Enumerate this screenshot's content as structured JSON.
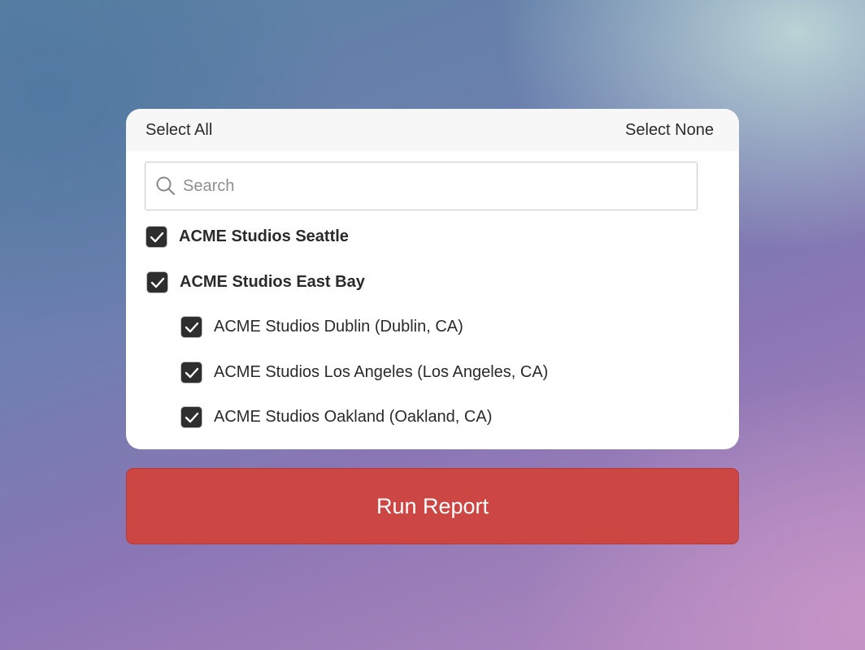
{
  "header": {
    "select_all": "Select All",
    "select_none": "Select None"
  },
  "search": {
    "placeholder": "Search",
    "value": "",
    "icon": "search-icon"
  },
  "locations": [
    {
      "label": "ACME Studios Seattle",
      "checked": true,
      "level": 0
    },
    {
      "label": "ACME Studios East Bay",
      "checked": true,
      "level": 0
    },
    {
      "label": "ACME Studios Dublin (Dublin, CA)",
      "checked": true,
      "level": 1
    },
    {
      "label": "ACME Studios Los Angeles (Los Angeles, CA)",
      "checked": true,
      "level": 1
    },
    {
      "label": "ACME Studios Oakland (Oakland, CA)",
      "checked": true,
      "level": 1
    }
  ],
  "actions": {
    "run_report": "Run Report"
  },
  "colors": {
    "run_button": "#cc4643",
    "checkbox": "#2e2e2e"
  }
}
